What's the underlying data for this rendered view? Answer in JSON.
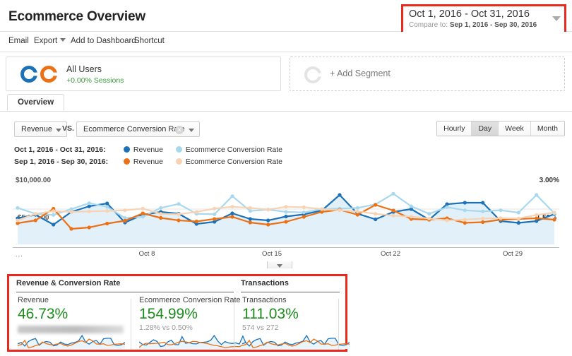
{
  "header": {
    "title": "Ecommerce Overview",
    "date_range": {
      "main": "Oct 1, 2016 - Oct 31, 2016",
      "compare_prefix": "Compare to: ",
      "compare_range": "Sep 1, 2016 - Sep 30, 2016",
      "highlight_color": "#e8291c"
    }
  },
  "actions": {
    "email": "Email",
    "export": "Export",
    "add_to_dashboard": "Add to Dashboard",
    "shortcut": "Shortcut"
  },
  "segments": {
    "applied": {
      "name": "All Users",
      "sub": "+0.00% Sessions",
      "sub_color": "#3a9a3a"
    },
    "add_label": "+ Add Segment"
  },
  "tabs": [
    {
      "label": "Overview",
      "active": true
    }
  ],
  "controls": {
    "metric_a": "Revenue",
    "vs": "VS.",
    "metric_b": "Ecommerce Conversion Rate",
    "granularity": [
      "Hourly",
      "Day",
      "Week",
      "Month"
    ],
    "granularity_active": "Day"
  },
  "legend": {
    "rows": [
      {
        "date": "Oct 1, 2016 - Oct 31, 2016:",
        "items": [
          {
            "label": "Revenue",
            "color": "#1b72b8"
          },
          {
            "label": "Ecommerce Conversion Rate",
            "color": "#a8d8ee"
          }
        ]
      },
      {
        "date": "Sep 1, 2016 - Sep 30, 2016:",
        "items": [
          {
            "label": "Revenue",
            "color": "#ec7014"
          },
          {
            "label": "Ecommerce Conversion Rate",
            "color": "#f7d3b4"
          }
        ]
      }
    ]
  },
  "chart_data": {
    "type": "line",
    "title": "Revenue vs Ecommerce Conversion Rate",
    "xlabel": "",
    "ylabel": "Revenue",
    "y2label": "Ecommerce Conversion Rate",
    "y_axis_labels": [
      "$10,000.00",
      "$5,000.00"
    ],
    "y2_axis_labels": [
      "3.00%",
      "1.50%"
    ],
    "ylim": [
      0,
      10000
    ],
    "y2lim": [
      0,
      3.0
    ],
    "xtick_labels": [
      "Oct 8",
      "Oct 15",
      "Oct 22",
      "Oct 29"
    ],
    "x_leading_ellipsis": "...",
    "grid": true,
    "legend_position": "above-plot",
    "x": [
      "Oct 1",
      "Oct 2",
      "Oct 3",
      "Oct 4",
      "Oct 5",
      "Oct 6",
      "Oct 7",
      "Oct 8",
      "Oct 9",
      "Oct 10",
      "Oct 11",
      "Oct 12",
      "Oct 13",
      "Oct 14",
      "Oct 15",
      "Oct 16",
      "Oct 17",
      "Oct 18",
      "Oct 19",
      "Oct 20",
      "Oct 21",
      "Oct 22",
      "Oct 23",
      "Oct 24",
      "Oct 25",
      "Oct 26",
      "Oct 27",
      "Oct 28",
      "Oct 29",
      "Oct 30",
      "Oct 31"
    ],
    "series": [
      {
        "name": "Revenue",
        "period": "Oct 1, 2016 - Oct 31, 2016",
        "color": "#1b72b8",
        "axis": "left",
        "values": [
          3700,
          4200,
          2800,
          4600,
          5400,
          5800,
          3100,
          4200,
          4600,
          4350,
          2900,
          3200,
          4400,
          3600,
          3400,
          3950,
          4250,
          4800,
          7000,
          4350,
          3550,
          4600,
          5000,
          3500,
          5700,
          5900,
          5900,
          3300,
          3050,
          3300,
          4300
        ]
      },
      {
        "name": "Ecommerce Conversion Rate",
        "period": "Oct 1, 2016 - Oct 31, 2016",
        "color": "#a8d8ee",
        "axis": "right",
        "values": [
          1.55,
          1.3,
          1.25,
          1.5,
          1.75,
          1.6,
          1.12,
          1.18,
          1.55,
          1.72,
          1.3,
          1.28,
          2.05,
          1.42,
          1.48,
          1.38,
          1.36,
          1.5,
          1.52,
          1.55,
          1.7,
          2.15,
          1.62,
          1.3,
          1.58,
          1.45,
          1.4,
          1.45,
          1.35,
          2.1,
          1.32
        ]
      },
      {
        "name": "Revenue",
        "period": "Sep 1, 2016 - Sep 30, 2016",
        "color": "#ec7014",
        "axis": "left",
        "values": [
          3000,
          3400,
          5050,
          2200,
          2400,
          2950,
          3350,
          4400,
          3750,
          3400,
          3250,
          3600,
          3900,
          3100,
          2800,
          3200,
          3900,
          4600,
          4900,
          4200,
          5600,
          4800,
          3600,
          3500,
          3700,
          3050,
          3150,
          3500,
          3600,
          3700,
          3500
        ]
      },
      {
        "name": "Ecommerce Conversion Rate",
        "period": "Sep 1, 2016 - Sep 30, 2016",
        "color": "#f7d3b4",
        "axis": "right",
        "values": [
          1.02,
          1.3,
          1.42,
          1.38,
          1.4,
          1.42,
          1.45,
          1.52,
          1.3,
          1.28,
          1.38,
          1.52,
          1.6,
          1.55,
          1.48,
          1.6,
          1.58,
          1.5,
          1.45,
          1.4,
          1.3,
          1.22,
          1.18,
          1.1,
          1.02,
          1.05,
          1.1,
          1.12,
          1.1,
          1.25,
          1.35
        ]
      }
    ]
  },
  "bottom": {
    "highlight_color": "#e8291c",
    "groups": [
      {
        "title": "Revenue & Conversion Rate",
        "metrics": [
          {
            "label": "Revenue",
            "value": "46.73%",
            "sub": "",
            "sub_redacted": true
          },
          {
            "label": "Ecommerce Conversion Rate",
            "value": "154.99%",
            "sub": "1.28% vs 0.50%",
            "sub_redacted": false
          }
        ]
      },
      {
        "title": "Transactions",
        "metrics": [
          {
            "label": "Transactions",
            "value": "111.03%",
            "sub": "574 vs 272",
            "sub_redacted": false
          }
        ]
      }
    ]
  },
  "icons": {
    "qr": "qr-code-icon",
    "academy": "graduation-cap-icon"
  }
}
